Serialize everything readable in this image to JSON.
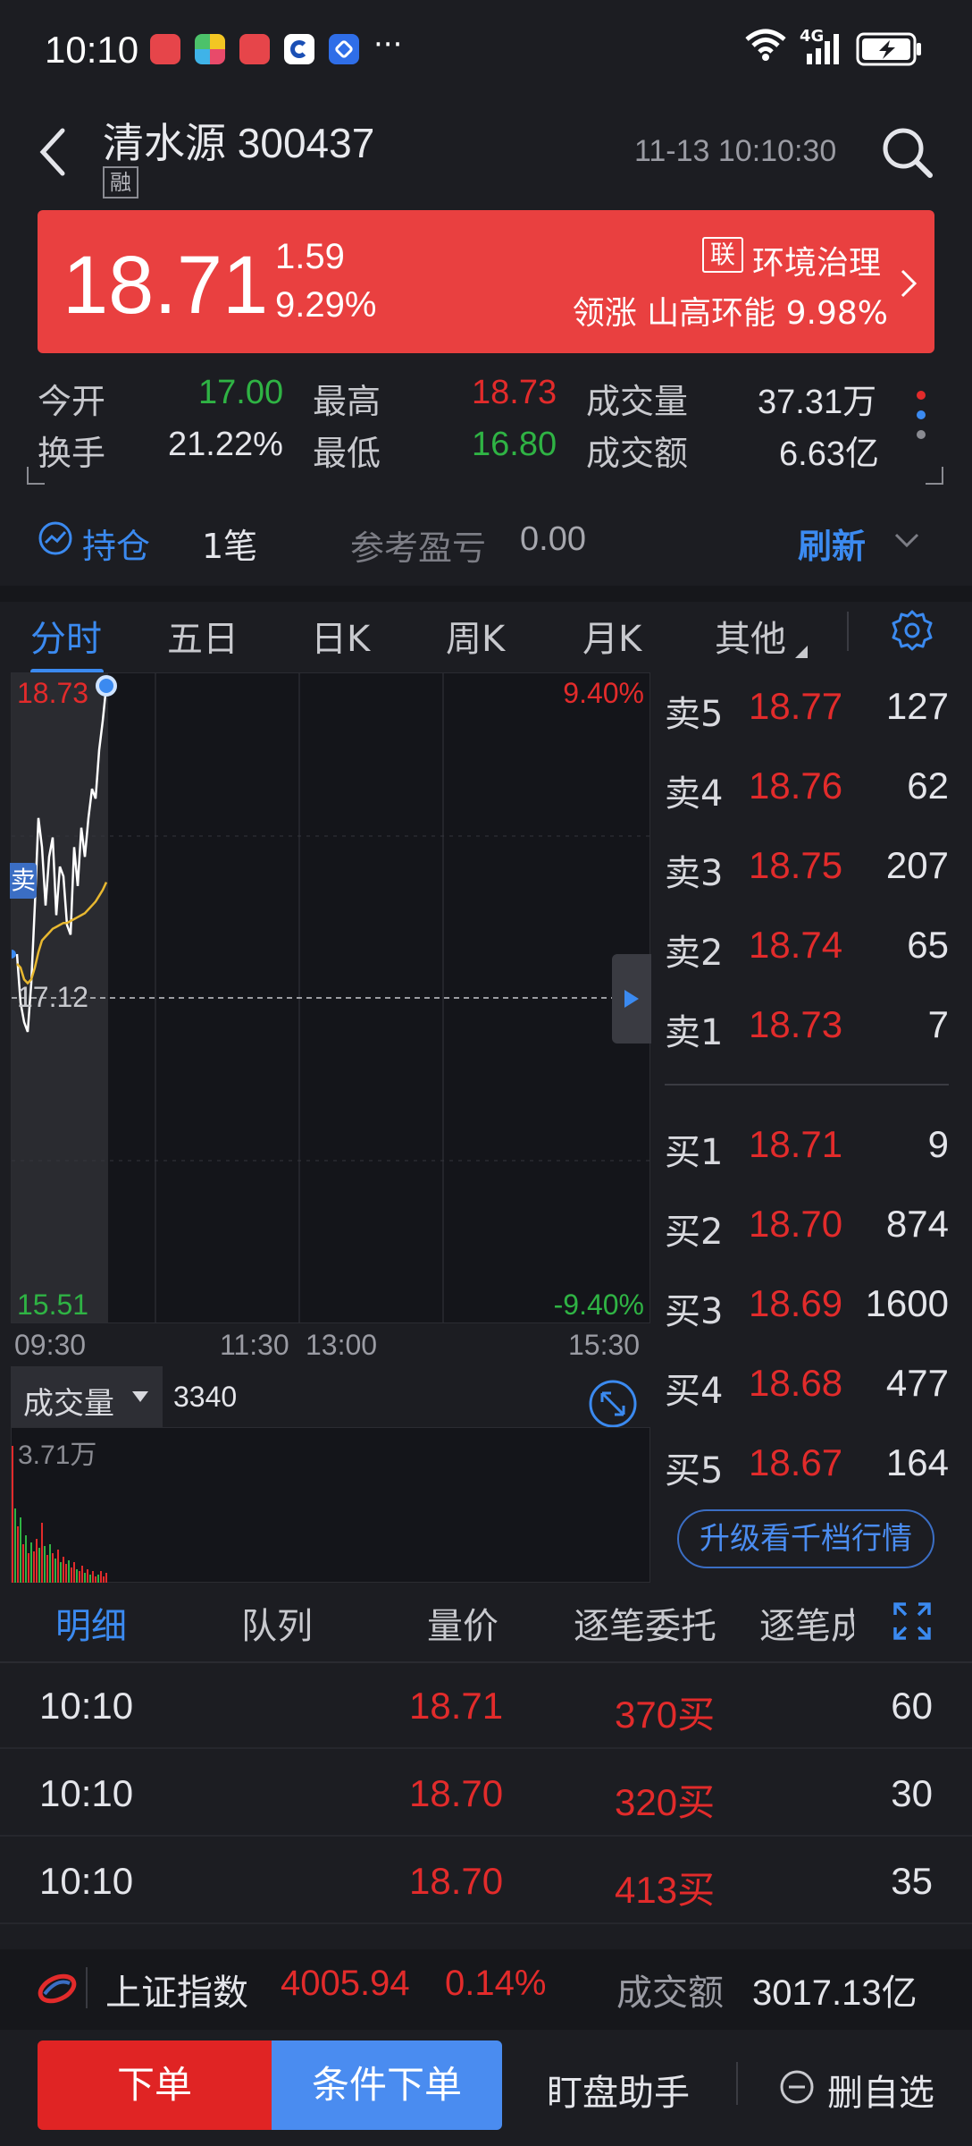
{
  "status_bar": {
    "time": "10:10",
    "more": "···",
    "network": "4G"
  },
  "header": {
    "stock": "清水源 300437",
    "margin_tag": "融",
    "datetime": "11-13 10:10:30"
  },
  "banner": {
    "price": "18.71",
    "change": "1.59",
    "change_pct": "9.29%",
    "tag": "联",
    "industry": "环境治理",
    "leader": "领涨 山高环能 9.98%",
    "bg_color": "#e94040"
  },
  "quote": {
    "open_label": "今开",
    "open": "17.00",
    "high_label": "最高",
    "high": "18.73",
    "volume_label": "成交量",
    "volume": "37.31万",
    "turnover_label": "换手",
    "turnover": "21.22%",
    "low_label": "最低",
    "low": "16.80",
    "amount_label": "成交额",
    "amount": "6.63亿"
  },
  "position": {
    "label": "持仓",
    "count": "1笔",
    "ref_label": "参考盈亏",
    "ref_value": "0.00",
    "refresh": "刷新"
  },
  "chart_tabs": [
    "分时",
    "五日",
    "日K",
    "周K",
    "月K",
    "其他"
  ],
  "chart": {
    "high_price": "18.73",
    "high_pct": "9.40%",
    "base_price": "17.12",
    "low_price": "15.51",
    "low_pct": "-9.40%",
    "flag": "卖",
    "times": [
      "09:30",
      "11:30",
      "13:00",
      "15:30"
    ]
  },
  "chart_data": {
    "type": "line",
    "ylim": [
      15.51,
      18.73
    ],
    "series": [
      {
        "values": [
          17.35,
          17.1,
          17.0,
          16.95,
          17.2,
          17.6,
          18.05,
          17.9,
          17.6,
          17.85,
          17.95,
          17.55,
          17.8,
          17.75,
          17.5,
          17.45,
          17.9,
          17.7,
          18.0,
          17.85,
          18.05,
          18.2,
          18.15,
          18.4,
          18.55,
          18.73
        ]
      },
      {
        "values": [
          17.3,
          17.28,
          17.22,
          17.2,
          17.22,
          17.28,
          17.36,
          17.42,
          17.44,
          17.46,
          17.48,
          17.49,
          17.5,
          17.51,
          17.51,
          17.52,
          17.53,
          17.54,
          17.55,
          17.56,
          17.58,
          17.6,
          17.62,
          17.65,
          17.68,
          17.72
        ]
      }
    ]
  },
  "volume": {
    "selector": "成交量",
    "value": "3340",
    "max": "3.71万"
  },
  "order_book": {
    "asks": [
      {
        "label": "卖5",
        "price": "18.77",
        "vol": "127"
      },
      {
        "label": "卖4",
        "price": "18.76",
        "vol": "62"
      },
      {
        "label": "卖3",
        "price": "18.75",
        "vol": "207"
      },
      {
        "label": "卖2",
        "price": "18.74",
        "vol": "65"
      },
      {
        "label": "卖1",
        "price": "18.73",
        "vol": "7"
      }
    ],
    "bids": [
      {
        "label": "买1",
        "price": "18.71",
        "vol": "9"
      },
      {
        "label": "买2",
        "price": "18.70",
        "vol": "874"
      },
      {
        "label": "买3",
        "price": "18.69",
        "vol": "1600"
      },
      {
        "label": "买4",
        "price": "18.68",
        "vol": "477"
      },
      {
        "label": "买5",
        "price": "18.67",
        "vol": "164"
      }
    ],
    "upgrade": "升级看千档行情"
  },
  "detail_tabs": [
    "明细",
    "队列",
    "量价",
    "逐笔委托",
    "逐笔成交"
  ],
  "details": [
    {
      "time": "10:10",
      "price": "18.71",
      "order": "370买",
      "vol": "60"
    },
    {
      "time": "10:10",
      "price": "18.70",
      "order": "320买",
      "vol": "30"
    },
    {
      "time": "10:10",
      "price": "18.70",
      "order": "413买",
      "vol": "35"
    }
  ],
  "index": {
    "name": "上证指数",
    "value": "4005.94",
    "pct": "0.14%",
    "amount_label": "成交额",
    "amount": "3017.13亿"
  },
  "actions": {
    "order": "下单",
    "conditional": "条件下单",
    "monitor": "盯盘助手",
    "remove": "删自选"
  },
  "colors": {
    "up": "#e22b2b",
    "down": "#2fb344",
    "accent": "#3b8af0"
  }
}
